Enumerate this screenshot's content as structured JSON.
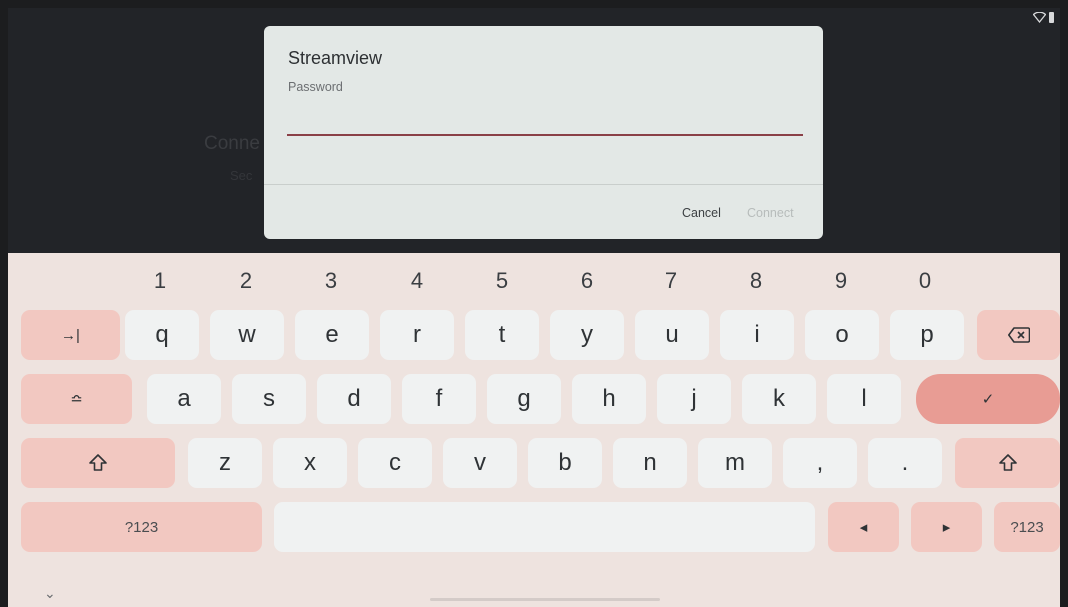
{
  "background": {
    "title_fragment": "Conne",
    "subtitle_fragment": "Sec"
  },
  "dialog": {
    "title": "Streamview",
    "password_label": "Password",
    "password_value": "",
    "cancel_label": "Cancel",
    "connect_label": "Connect"
  },
  "keyboard": {
    "numbers": [
      "1",
      "2",
      "3",
      "4",
      "5",
      "6",
      "7",
      "8",
      "9",
      "0"
    ],
    "row1": [
      "q",
      "w",
      "e",
      "r",
      "t",
      "y",
      "u",
      "i",
      "o",
      "p"
    ],
    "row2": [
      "a",
      "s",
      "d",
      "f",
      "g",
      "h",
      "j",
      "k",
      "l"
    ],
    "row3": [
      "z",
      "x",
      "c",
      "v",
      "b",
      "n",
      "m",
      ",",
      "."
    ],
    "tab_symbol": "→|",
    "caps_symbol": "≏",
    "enter_symbol": "✓",
    "symbols_left_label": "?123",
    "symbols_right_label": "?123",
    "left_arrow_symbol": "◂",
    "right_arrow_symbol": "▸",
    "collapse_symbol": "⌄",
    "colors": {
      "function_key": "#f2c8c1",
      "enter_key": "#e89c94",
      "letter_key": "#f0f2f2",
      "underline": "#8a4047"
    }
  }
}
